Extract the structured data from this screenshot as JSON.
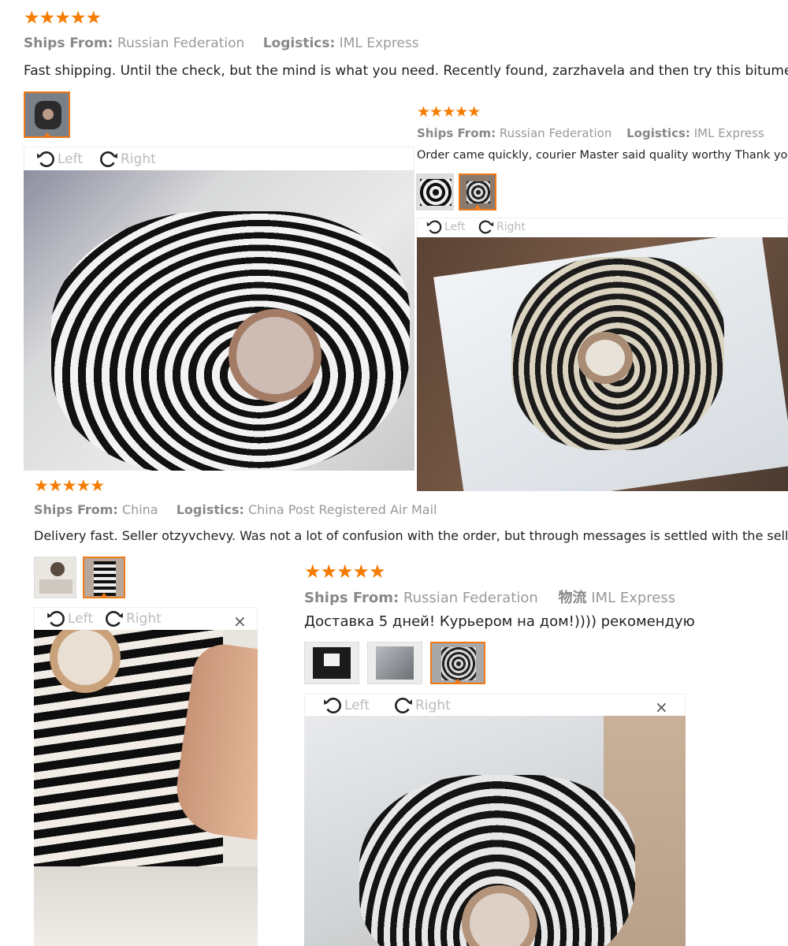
{
  "reviews": [
    {
      "stars": "★★★★★",
      "ships_label": "Ships From:",
      "ships_value": "Russian Federation",
      "logistics_label": "Logistics:",
      "logistics_value": "IML Express",
      "text": "Fast shipping. Until the check, but the mind is what you need. Recently found, zarzhavela and then try this bitumen",
      "rotate_left": "Left",
      "rotate_right": "Right"
    },
    {
      "stars": "★★★★★",
      "ships_label": "Ships From:",
      "ships_value": "Russian Federation",
      "logistics_label": "Logistics:",
      "logistics_value": "IML Express",
      "text": "Order came quickly, courier Master said quality worthy Thank you",
      "rotate_left": "Left",
      "rotate_right": "Right"
    },
    {
      "stars": "★★★★★",
      "ships_label": "Ships From:",
      "ships_value": "China",
      "logistics_label": "Logistics:",
      "logistics_value": "China Post Registered Air Mail",
      "text": "Delivery fast. Seller otzyvchevy. Was not a lot of confusion with the order, but through messages is settled with the seller",
      "rotate_left": "Left",
      "rotate_right": "Right",
      "close": "×"
    },
    {
      "stars": "★★★★★",
      "ships_label": "Ships From:",
      "ships_value": "Russian Federation",
      "logistics_label": "物流",
      "logistics_value": "IML Express",
      "text": "Доставка 5 дней! Курьером на дом!)))) рекомендую",
      "rotate_left": "Left",
      "rotate_right": "Right",
      "close": "×"
    }
  ],
  "colors": {
    "accent": "#f07a1a",
    "stars": "#f57c00"
  }
}
